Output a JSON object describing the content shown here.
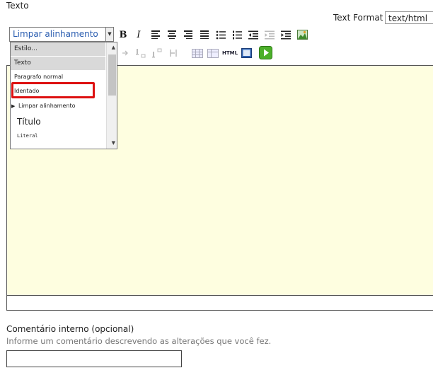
{
  "section": {
    "title": "Texto"
  },
  "text_format": {
    "label": "Text Format",
    "value": "text/html"
  },
  "toolbar": {
    "style_select_value": "Limpar alinhamento",
    "bold_glyph": "B",
    "italic_glyph": "I",
    "html_label": "HTML"
  },
  "style_dropdown": {
    "items": [
      {
        "label": "Estilo..."
      },
      {
        "label": "Texto"
      },
      {
        "label": "Paragrafo normal"
      },
      {
        "label": "Identado"
      },
      {
        "label": "Limpar alinhamento"
      },
      {
        "label": "Título"
      },
      {
        "label": "Literal"
      }
    ]
  },
  "comment": {
    "label": "Comentário interno (opcional)",
    "help": "Informe um comentário descrevendo as alterações que você fez.",
    "value": ""
  },
  "colors": {
    "editor_bg": "#fefee0",
    "highlight": "#dd1111",
    "link_blue": "#2a5db0"
  }
}
